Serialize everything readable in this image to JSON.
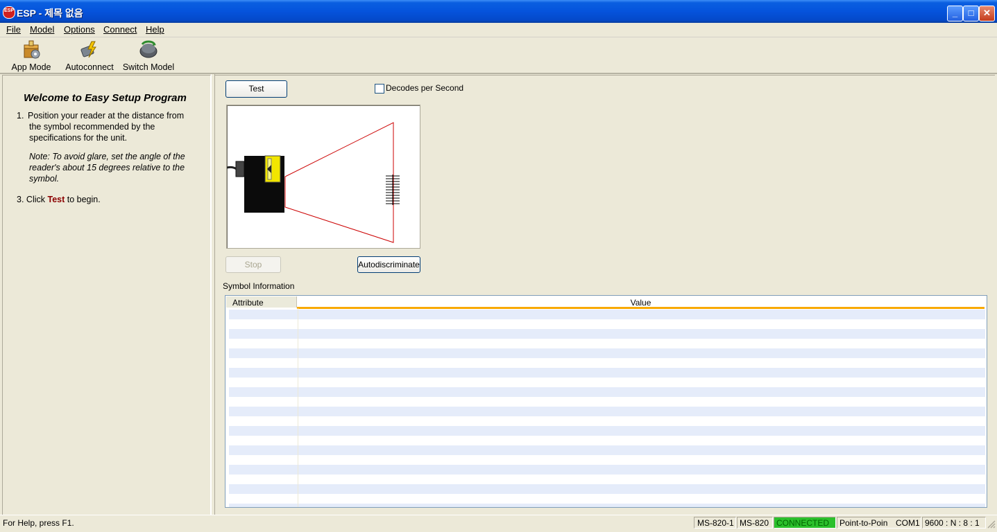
{
  "window": {
    "title": "ESP - 제목 없음",
    "app_icon_text": "ESP",
    "buttons": {
      "minimize": "_",
      "maximize": "□",
      "close": "✕"
    }
  },
  "menu": [
    "File",
    "Model",
    "Options",
    "Connect",
    "Help"
  ],
  "toolbar": {
    "app_mode": "App Mode",
    "autoconnect": "Autoconnect",
    "switch_model": "Switch Model"
  },
  "instructions": {
    "title": "Welcome to Easy Setup Program",
    "step1_num": "1.",
    "step1_lines": [
      "Position your reader at the distance from",
      "the symbol recommended by the",
      "specifications for the unit."
    ],
    "note_lines": [
      "Note: To avoid glare, set the angle of the",
      "reader's about 15 degrees relative to the",
      "symbol."
    ],
    "step3_num": "3.",
    "step3_pre": "Click ",
    "step3_bold": "Test",
    "step3_post": " to begin."
  },
  "controls": {
    "test_button": "Test",
    "decodes_label": "Decodes per Second",
    "decodes_checked": false,
    "stop_button": "Stop",
    "autodiscriminate_button": "Autodiscriminate"
  },
  "symbol_info": {
    "label": "Symbol Information",
    "columns": [
      "Attribute",
      "Value"
    ],
    "row_count": 21
  },
  "status": {
    "help": "For Help, press F1.",
    "model_id": "MS-820-1",
    "model": "MS-820",
    "connection": "CONNECTED",
    "mode": "Point-to-Poin",
    "port": "COM1",
    "settings": "9600 : N : 8 : 1"
  },
  "colors": {
    "connected_bg": "#2bc02b",
    "beam": "#cc0000",
    "reader_label": "#f2e600",
    "header_accent": "#f8a900",
    "row_alt": "#e5ecfa"
  }
}
